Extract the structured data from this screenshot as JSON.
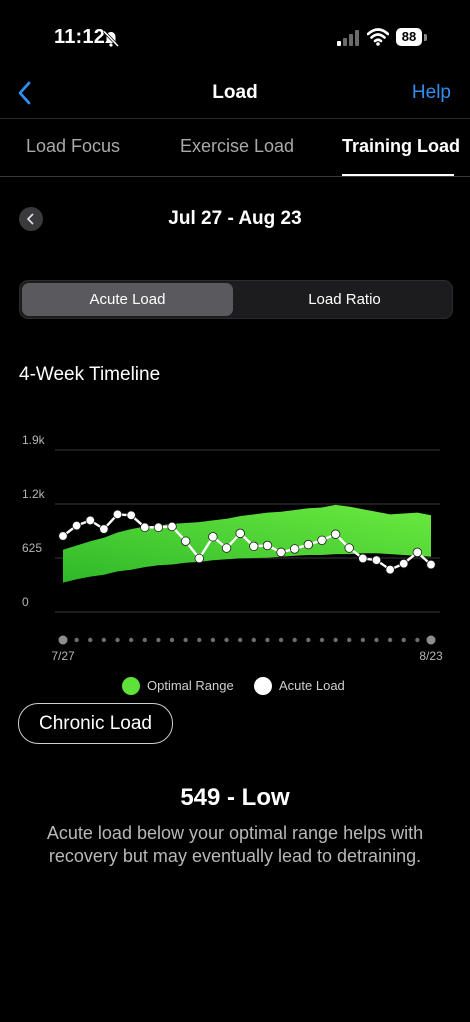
{
  "status": {
    "time": "11:12",
    "battery": "88"
  },
  "nav": {
    "title": "Load",
    "help": "Help"
  },
  "tabs": [
    "Load Focus",
    "Exercise Load",
    "Training Load"
  ],
  "date_range": "Jul 27 - Aug 23",
  "segments": [
    "Acute Load",
    "Load Ratio"
  ],
  "section_title": "4-Week Timeline",
  "colors": {
    "optimal": "#5ee23a",
    "acute": "#ffffff",
    "accent": "#2f8ff0"
  },
  "chart_data": {
    "type": "line",
    "title": "4-Week Timeline",
    "y_ticks": [
      "0",
      "625",
      "1.2k",
      "1.9k"
    ],
    "y_tick_values": [
      0,
      625,
      1250,
      1875
    ],
    "ylim": [
      0,
      1875
    ],
    "x_tick_labels": [
      "7/27",
      "8/23"
    ],
    "x": [
      "7/27",
      "7/28",
      "7/29",
      "7/30",
      "7/31",
      "8/1",
      "8/2",
      "8/3",
      "8/4",
      "8/5",
      "8/6",
      "8/7",
      "8/8",
      "8/9",
      "8/10",
      "8/11",
      "8/12",
      "8/13",
      "8/14",
      "8/15",
      "8/16",
      "8/17",
      "8/18",
      "8/19",
      "8/20",
      "8/21",
      "8/22",
      "8/23"
    ],
    "series": [
      {
        "name": "Acute Load",
        "values": [
          880,
          1000,
          1060,
          960,
          1130,
          1120,
          980,
          980,
          990,
          820,
          620,
          870,
          740,
          910,
          760,
          770,
          690,
          730,
          780,
          830,
          900,
          740,
          620,
          600,
          490,
          560,
          690,
          549
        ]
      },
      {
        "name": "Optimal Range",
        "type": "area",
        "lower": [
          340,
          380,
          410,
          430,
          470,
          490,
          520,
          540,
          550,
          570,
          580,
          600,
          610,
          620,
          625,
          630,
          640,
          650,
          660,
          660,
          670,
          670,
          680,
          680,
          670,
          660,
          650,
          640
        ],
        "upper": [
          720,
          770,
          820,
          860,
          920,
          960,
          990,
          1000,
          1020,
          1030,
          1040,
          1060,
          1080,
          1110,
          1130,
          1150,
          1160,
          1180,
          1200,
          1210,
          1240,
          1220,
          1190,
          1160,
          1130,
          1140,
          1150,
          1120
        ]
      }
    ],
    "legend": [
      "Optimal Range",
      "Acute Load"
    ],
    "grid": true
  },
  "chronic_button": "Chronic Load",
  "value_text": "549 - Low",
  "description": "Acute load below your optimal range helps with recovery but may eventually lead to detraining."
}
